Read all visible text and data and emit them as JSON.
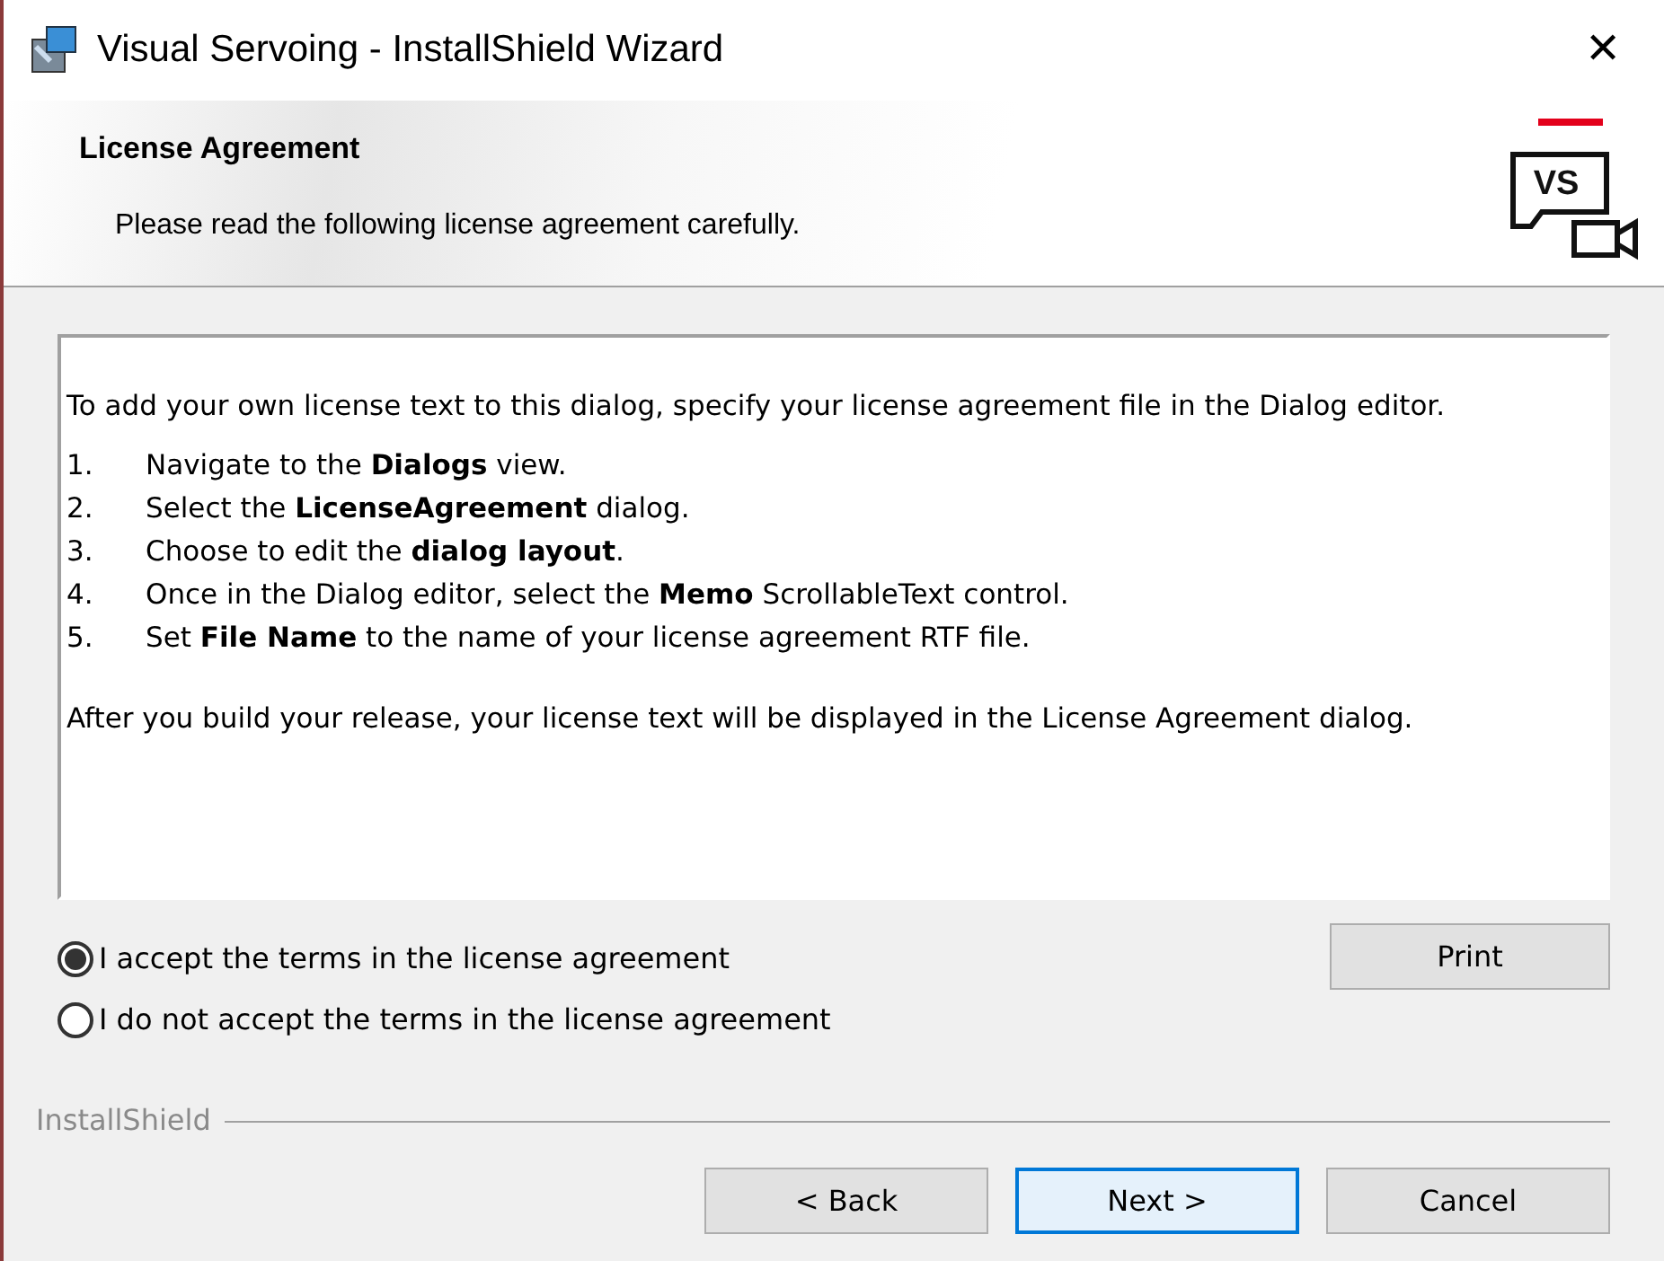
{
  "window": {
    "title": "Visual Servoing - InstallShield Wizard",
    "close": "✕"
  },
  "header": {
    "title": "License Agreement",
    "subtitle": "Please read the following license agreement carefully.",
    "logo_text": "VS"
  },
  "license": {
    "intro": "To add your own license text to this dialog, specify your license agreement file in the Dialog editor.",
    "steps": [
      {
        "number": "1.",
        "text": "Navigate to the **Dialogs** view."
      },
      {
        "number": "2.",
        "text": "Select the **LicenseAgreement** dialog."
      },
      {
        "number": "3.",
        "text": "Choose to edit the **dialog layout**."
      },
      {
        "number": "4.",
        "text": "Once in the Dialog editor, select the **Memo** ScrollableText control."
      },
      {
        "number": "5.",
        "text": "Set **File Name** to the name of your license agreement RTF file."
      }
    ],
    "outro": "After you build your release, your license text will be displayed in the License Agreement dialog."
  },
  "options": [
    {
      "label": "I accept the terms in the license agreement",
      "selected": true
    },
    {
      "label": "I do not accept the terms in the license agreement",
      "selected": false
    }
  ],
  "print_button": "Print",
  "brand": "InstallShield",
  "buttons": [
    {
      "label": "< Back",
      "focused": false
    },
    {
      "label": "Next >",
      "focused": true
    },
    {
      "label": "Cancel",
      "focused": false
    }
  ]
}
